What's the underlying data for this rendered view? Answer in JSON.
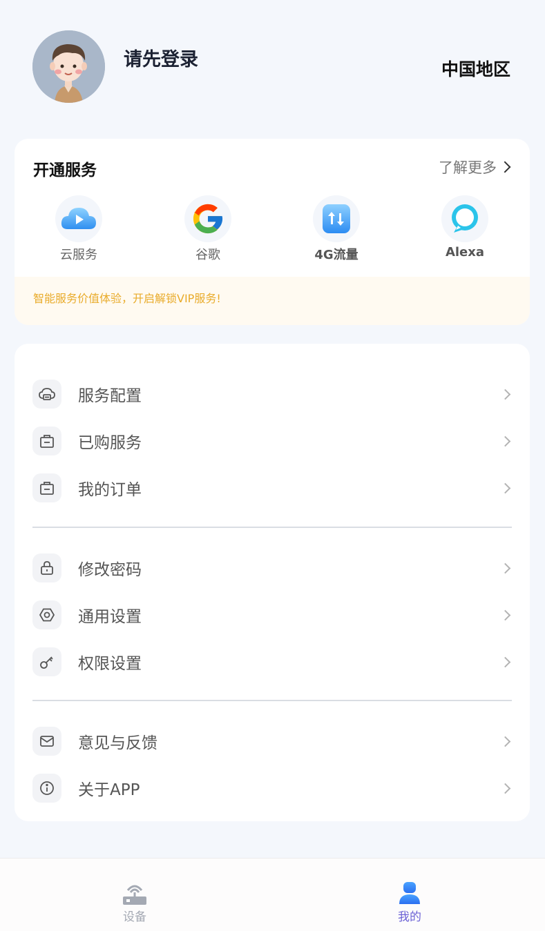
{
  "header": {
    "login_prompt": "请先登录",
    "region": "中国地区"
  },
  "services": {
    "title": "开通服务",
    "learn_more": "了解更多",
    "items": [
      {
        "label": "云服务",
        "icon": "cloud-play-icon"
      },
      {
        "label": "谷歌",
        "icon": "google-icon"
      },
      {
        "label": "4G流量",
        "icon": "data-traffic-icon"
      },
      {
        "label": "Alexa",
        "icon": "alexa-icon"
      }
    ],
    "vip_banner": "智能服务价值体验，开启解锁VIP服务!"
  },
  "menu": {
    "groups": [
      [
        {
          "label": "服务配置",
          "icon": "cloud-service-icon"
        },
        {
          "label": "已购服务",
          "icon": "shopping-bag-icon"
        },
        {
          "label": "我的订单",
          "icon": "order-bag-icon"
        }
      ],
      [
        {
          "label": "修改密码",
          "icon": "lock-icon"
        },
        {
          "label": "通用设置",
          "icon": "hexagon-settings-icon"
        },
        {
          "label": "权限设置",
          "icon": "key-icon"
        }
      ],
      [
        {
          "label": "意见与反馈",
          "icon": "mail-icon"
        },
        {
          "label": "关于APP",
          "icon": "info-icon"
        }
      ]
    ]
  },
  "bottom_nav": {
    "items": [
      {
        "label": "设备",
        "icon": "device-router-icon",
        "active": false
      },
      {
        "label": "我的",
        "icon": "user-profile-icon",
        "active": true
      }
    ]
  },
  "colors": {
    "background": "#f4f7fc",
    "vip_text": "#e9ab2a",
    "active_nav": "#6d63d6",
    "inactive_nav": "#a4a9b3"
  }
}
